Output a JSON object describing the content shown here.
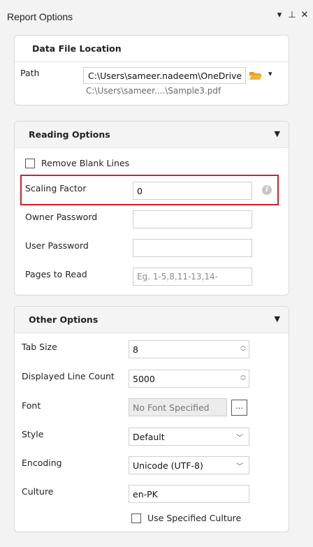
{
  "window": {
    "title": "Report Options",
    "ctrl_menu": "▾",
    "ctrl_pin": "⊥",
    "ctrl_close": "✕"
  },
  "data_file": {
    "header": "Data File Location",
    "path_label": "Path",
    "path_value": "C:\\Users\\sameer.nadeem\\OneDrive",
    "path_hint": "C:\\Users\\sameer....\\Sample3.pdf",
    "dropdown_glyph": "▾"
  },
  "reading": {
    "header": "Reading Options",
    "chevron": "▼",
    "remove_blank_lines": {
      "label": "Remove Blank Lines",
      "checked": false
    },
    "scaling_factor": {
      "label": "Scaling Factor",
      "value": "0"
    },
    "owner_password": {
      "label": "Owner Password",
      "value": ""
    },
    "user_password": {
      "label": "User Password",
      "value": ""
    },
    "pages_to_read": {
      "label": "Pages to Read",
      "placeholder": "Eg. 1-5,8,11-13,14-"
    }
  },
  "other": {
    "header": "Other Options",
    "chevron": "▼",
    "tab_size": {
      "label": "Tab Size",
      "value": "8"
    },
    "displayed_line_count": {
      "label": "Displayed Line Count",
      "value": "5000"
    },
    "font": {
      "label": "Font",
      "value": "No Font Specified",
      "browse": "..."
    },
    "style": {
      "label": "Style",
      "value": "Default"
    },
    "encoding": {
      "label": "Encoding",
      "value": "Unicode (UTF-8)"
    },
    "culture": {
      "label": "Culture",
      "value": "en-PK"
    },
    "use_specified_culture": {
      "label": "Use Specified Culture",
      "checked": false
    }
  },
  "icons": {
    "info": "i",
    "spin_up": "︿",
    "spin_down": "﹀",
    "select_arrow": "﹀"
  },
  "colors": {
    "highlight": "#d0202a",
    "folder": "#f0b232"
  }
}
